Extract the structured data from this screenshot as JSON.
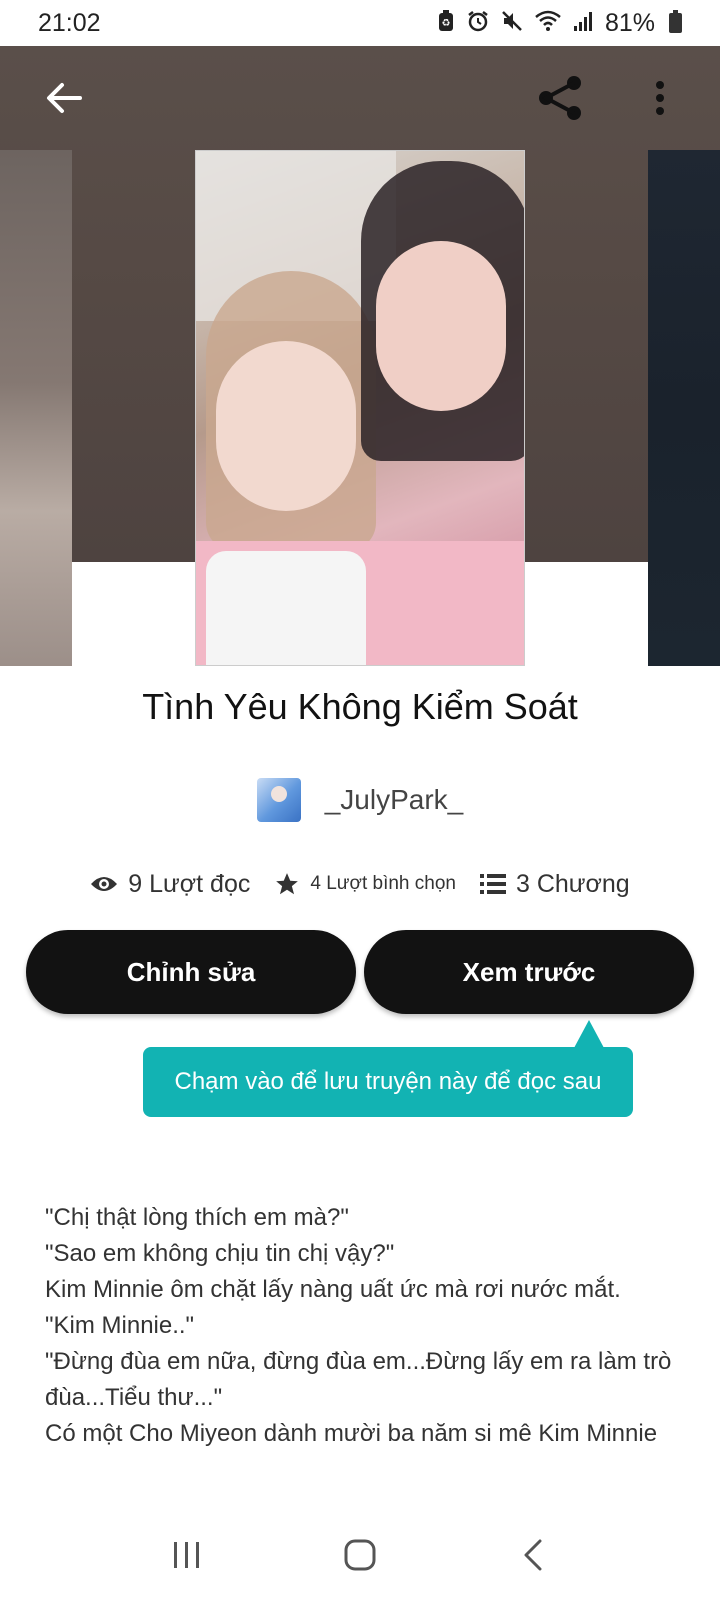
{
  "status_bar": {
    "time": "21:02",
    "battery": "81%",
    "icons": [
      "battery-saver-icon",
      "alarm-icon",
      "mute-icon",
      "wifi-icon",
      "signal-icon",
      "battery-icon"
    ]
  },
  "toolbar": {
    "back_icon": "back-arrow-icon",
    "share_icon": "share-icon",
    "more_icon": "more-vertical-icon"
  },
  "story": {
    "title": "Tình Yêu Không Kiểm Soát",
    "author": "_JulyPark_",
    "reads": "9 Lượt đọc",
    "votes": "4 Lượt bình chọn",
    "parts": "3 Chương"
  },
  "actions": {
    "edit_label": "Chỉnh sửa",
    "preview_label": "Xem trước"
  },
  "tooltip": {
    "text": "Chạm vào để lưu truyện này để đọc sau"
  },
  "description": {
    "lines": [
      "\"Chị thật lòng thích em mà?\"",
      "\"Sao em không chịu tin chị vậy?\"",
      "Kim Minnie ôm chặt lấy nàng uất ức mà rơi nước mắt.",
      "\"Kim Minnie..\"",
      "\"Đừng đùa em nữa, đừng đùa em...Đừng lấy em ra làm trò đùa...Tiểu thư...\"",
      "Có một Cho Miyeon dành mười ba năm si mê Kim Minnie"
    ]
  },
  "colors": {
    "accent": "#12b3b3",
    "button_bg": "#121212"
  }
}
